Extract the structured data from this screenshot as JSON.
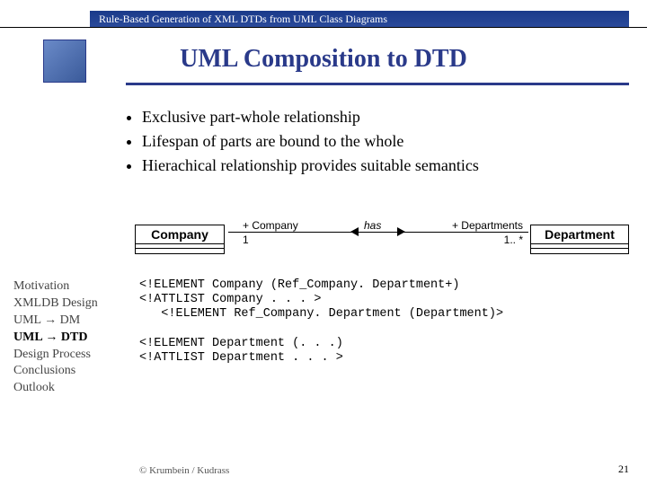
{
  "header": {
    "super_title": "Rule-Based Generation of XML DTDs from UML Class Diagrams"
  },
  "title": "UML Composition to DTD",
  "bullets": [
    "Exclusive part-whole relationship",
    "Lifespan of parts are bound to the whole",
    "Hierachical relationship provides suitable semantics"
  ],
  "diagram": {
    "left_class": "Company",
    "right_class": "Department",
    "role_left": "+ Company",
    "assoc_label": "has",
    "role_right": "+ Departments",
    "card_left": "1",
    "card_right": "1.. *"
  },
  "nav": {
    "items": [
      "Motivation",
      "XMLDB Design",
      "UML → DM",
      "UML → DTD",
      "Design Process",
      "Conclusions",
      "Outlook"
    ],
    "current_index": 3
  },
  "code": "<!ELEMENT Company (Ref_Company. Department+)\n<!ATTLIST Company . . . >\n   <!ELEMENT Ref_Company. Department (Department)>\n\n<!ELEMENT Department (. . .)\n<!ATTLIST Department . . . >",
  "footer": {
    "credit": "© Krumbein / Kudrass",
    "page": "21"
  }
}
